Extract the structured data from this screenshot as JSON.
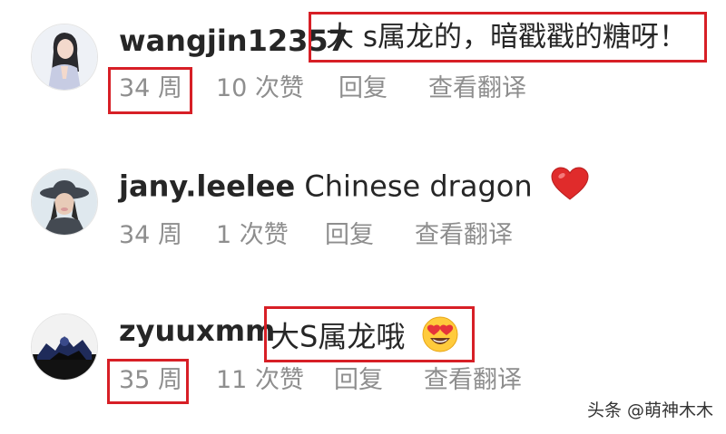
{
  "comments": [
    {
      "username": "wangjin12357",
      "text": "大 s属龙的，暗戳戳的糖呀！",
      "time": "34 周",
      "likes": "10 次赞",
      "reply": "回复",
      "translate": "查看翻译",
      "highlighted": true
    },
    {
      "username": "jany.leelee",
      "text": "Chinese dragon",
      "emoji": "red-heart-icon",
      "time": "34 周",
      "likes": "1 次赞",
      "reply": "回复",
      "translate": "查看翻译",
      "highlighted": false
    },
    {
      "username": "zyuuxmm",
      "text": "大S属龙哦",
      "emoji": "heart-eyes-face-icon",
      "time": "35 周",
      "likes": "11 次赞",
      "reply": "回复",
      "translate": "查看翻译",
      "highlighted": true
    }
  ],
  "watermark": "头条 @萌神木木",
  "colors": {
    "highlight_border": "#d71f26",
    "meta_text": "#8e8e8e",
    "primary_text": "#262626"
  }
}
